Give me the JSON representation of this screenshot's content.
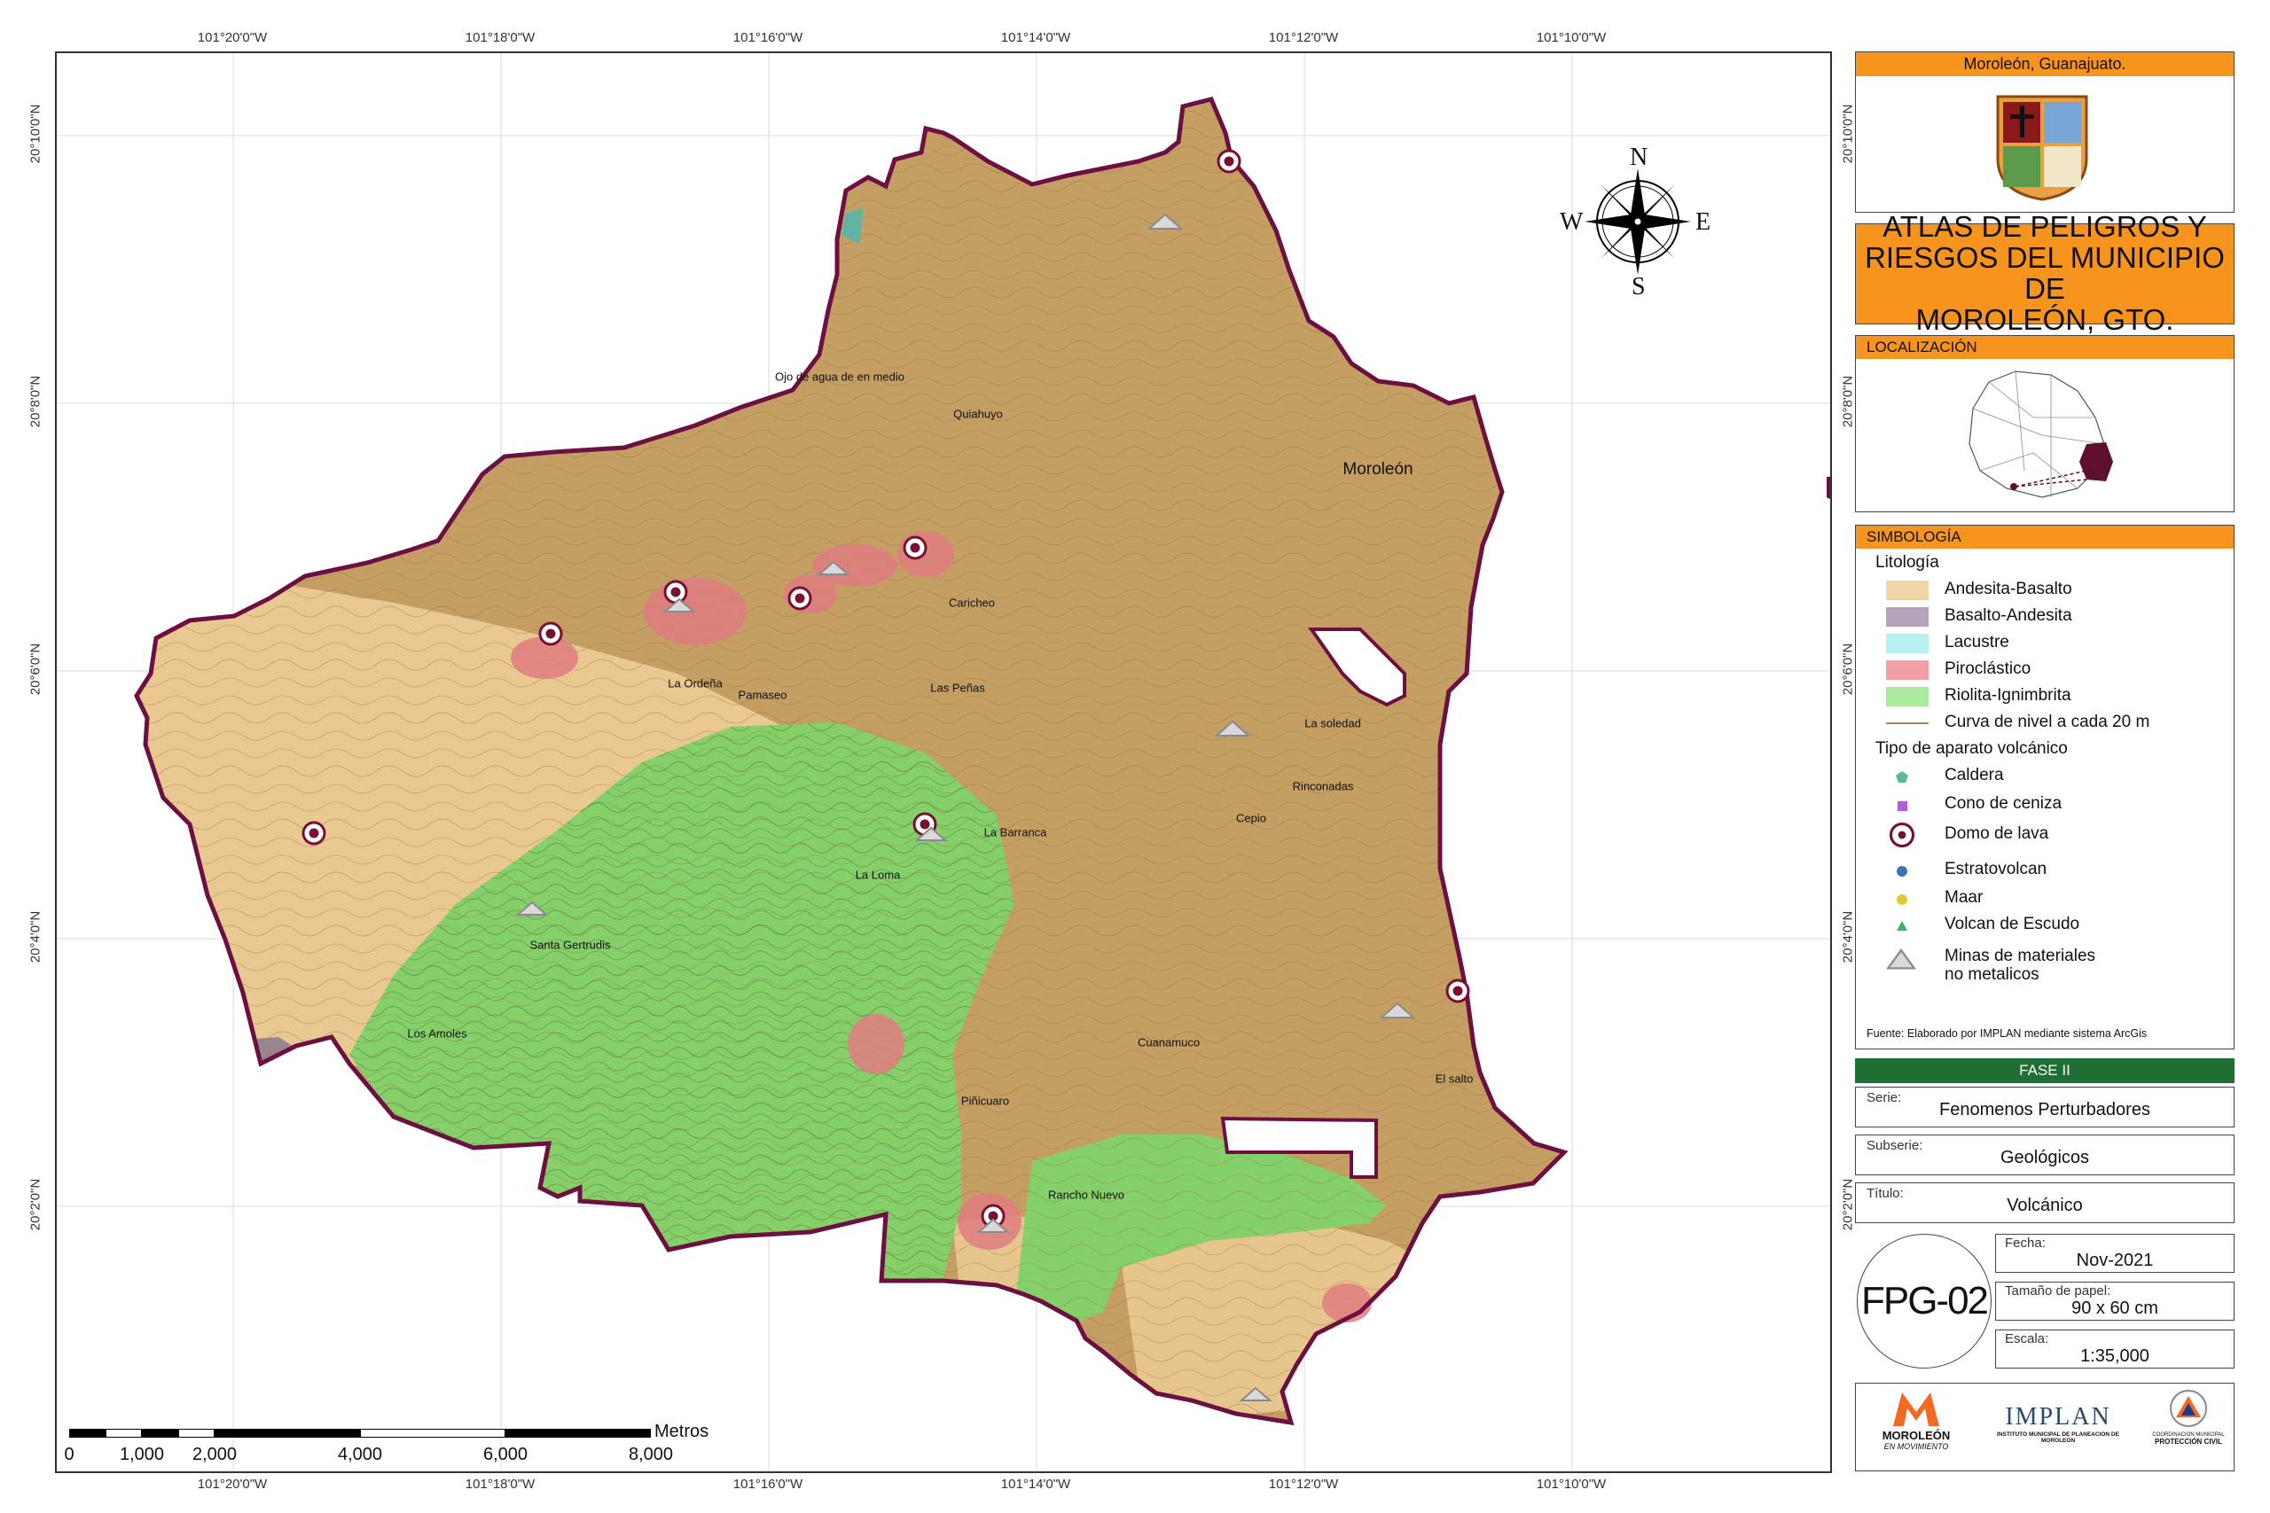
{
  "map": {
    "lon_labels_top": [
      "101°20'0\"W",
      "101°18'0\"W",
      "101°16'0\"W",
      "101°14'0\"W",
      "101°12'0\"W",
      "101°10'0\"W"
    ],
    "lon_labels_bottom": [
      "101°20'0\"W",
      "101°18'0\"W",
      "101°16'0\"W",
      "101°14'0\"W",
      "101°12'0\"W",
      "101°10'0\"W"
    ],
    "lat_labels": [
      "20°10'0\"N",
      "20°8'0\"N",
      "20°6'0\"N",
      "20°4'0\"N",
      "20°2'0\"N"
    ],
    "places": [
      {
        "name": "Ojo de agua de en medio"
      },
      {
        "name": "Quiahuyo"
      },
      {
        "name": "Moroleón"
      },
      {
        "name": "Caricheo"
      },
      {
        "name": "La Ordeña"
      },
      {
        "name": "Pamaseo"
      },
      {
        "name": "Las Peñas"
      },
      {
        "name": "La soledad"
      },
      {
        "name": "Rinconadas"
      },
      {
        "name": "Cepio"
      },
      {
        "name": "La Barranca"
      },
      {
        "name": "La Loma"
      },
      {
        "name": "Santa Gertrudis"
      },
      {
        "name": "Los Amoles"
      },
      {
        "name": "Cuanamuco"
      },
      {
        "name": "El salto"
      },
      {
        "name": "Piñicuaro"
      },
      {
        "name": "Rancho Nuevo"
      }
    ],
    "compass": {
      "n": "N",
      "s": "S",
      "e": "E",
      "w": "W"
    },
    "scale": {
      "labels": [
        "0",
        "1,000",
        "2,000",
        "4,000",
        "6,000",
        "8,000"
      ],
      "units": "Metros"
    },
    "colors": {
      "andesita_basalto": "#c49e62",
      "andesita_light": "#f0d09a",
      "basalto_andesita": "#9a8691",
      "riolita_ignimbrita": "#86d06a",
      "piroclastico": "#e07d80",
      "boundary": "#6b1040"
    }
  },
  "panel": {
    "municipio": "Moroleón, Guanajuato.",
    "title_lines": [
      "ATLAS DE PELIGROS Y",
      "RIESGOS DEL MUNICIPIO DE",
      "MOROLEÓN, GTO."
    ],
    "localizacion_label": "LOCALIZACIÓN",
    "simbologia_label": "SIMBOLOGÍA",
    "litologia_label": "Litología",
    "litologia": [
      {
        "label": "Andesita-Basalto",
        "color": "#f1d6a8"
      },
      {
        "label": "Basalto-Andesita",
        "color": "#b5a3bb"
      },
      {
        "label": "Lacustre",
        "color": "#b6f0f0"
      },
      {
        "label": "Piroclástico",
        "color": "#f0a0a6"
      },
      {
        "label": "Riolita-Ignimbrita",
        "color": "#a9ea9d"
      }
    ],
    "curva_label": "Curva de nivel a cada 20 m",
    "tipo_label": "Tipo de aparato volcánico",
    "aparatos": [
      {
        "label": "Caldera",
        "icon": "pentagon-icon",
        "color": "#5ab99b"
      },
      {
        "label": "Cono de ceniza",
        "icon": "square-icon",
        "color": "#b05fd6"
      },
      {
        "label": "Domo de lava",
        "icon": "domo-icon",
        "color": "#7a1030"
      },
      {
        "label": "Estratovolcan",
        "icon": "circle-icon",
        "color": "#3c73b8"
      },
      {
        "label": "Maar",
        "icon": "circle-icon",
        "color": "#e3c83a"
      },
      {
        "label": "Volcan de Escudo",
        "icon": "triangle-icon",
        "color": "#3cb45a"
      }
    ],
    "minas_label_1": "Minas de materiales",
    "minas_label_2": "no metalicos",
    "fuente": "Fuente: Elaborado por IMPLAN mediante sistema ArcGis",
    "fase": "FASE II",
    "serie_key": "Serie:",
    "serie": "Fenomenos Perturbadores",
    "subserie_key": "Subserie:",
    "subserie": "Geológicos",
    "titulo_key": "Título:",
    "titulo": "Volcánico",
    "code": "FPG-02",
    "fecha_key": "Fecha:",
    "fecha": "Nov-2021",
    "papel_key": "Tamaño de papel:",
    "papel": "90 x 60 cm",
    "escala_key": "Escala:",
    "escala": "1:35,000",
    "logos": {
      "moroleon": "MOROLEÓN",
      "moroleon_sub": "EN MOVIMIENTO",
      "implan": "IMPLAN",
      "implan_sub": "INSTITUTO MUNICIPAL DE PLANEACION DE MOROLEON",
      "pc_top": "COORDINACION MUNICIPAL",
      "pc": "PROTECCIÓN CIVIL"
    }
  }
}
